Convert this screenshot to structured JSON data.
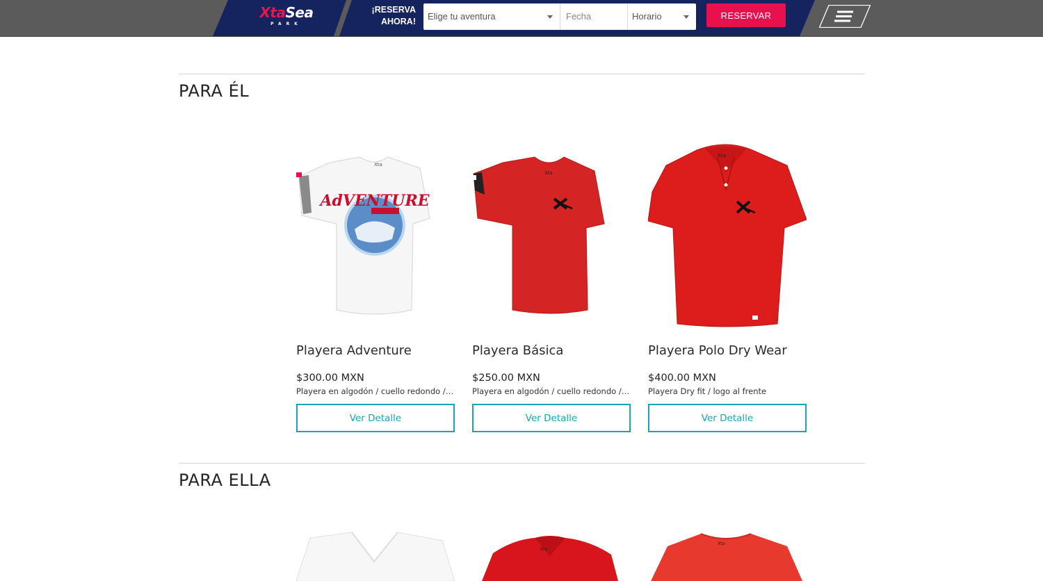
{
  "header": {
    "logo_main_part1": "Xta",
    "logo_main_part2": "Sea",
    "logo_sub": "PARK",
    "reserva_line1": "¡RESERVA",
    "reserva_line2": "AHORA!",
    "adventure_placeholder": "Elige tu aventura",
    "date_placeholder": "Fecha",
    "time_placeholder": "Horario",
    "reserve_button": "RESERVAR",
    "menu_icon": "hamburger-menu-icon"
  },
  "sections": [
    {
      "title": "PARA ÉL",
      "products": [
        {
          "name": "Playera Adventure",
          "price": "$300.00 MXN",
          "description": "Playera en algodón / cuello redondo / logo al frente",
          "button": "Ver Detalle",
          "image": "white-tshirt-adventure-print",
          "color": "#ffffff"
        },
        {
          "name": "Playera Básica",
          "price": "$250.00 MXN",
          "description": "Playera en algodón / cuello redondo / logo al frente",
          "button": "Ver Detalle",
          "image": "red-tshirt-logo",
          "color": "#d82020"
        },
        {
          "name": "Playera Polo Dry Wear",
          "price": "$400.00 MXN",
          "description": "Playera Dry fit / logo al frente",
          "button": "Ver Detalle",
          "image": "red-polo-shirt",
          "color": "#e01c1c"
        }
      ]
    },
    {
      "title": "PARA ELLA",
      "products": [
        {
          "image": "white-vneck-shirt",
          "color": "#ffffff"
        },
        {
          "image": "red-polo-shirt-women",
          "color": "#dc1a1a"
        },
        {
          "image": "red-tshirt-women",
          "color": "#e8392e"
        }
      ]
    }
  ],
  "colors": {
    "header_gray": "#5b5b5b",
    "header_navy": "#15235f",
    "brand_red": "#e8104d",
    "accent_teal": "#1aa3b8"
  }
}
